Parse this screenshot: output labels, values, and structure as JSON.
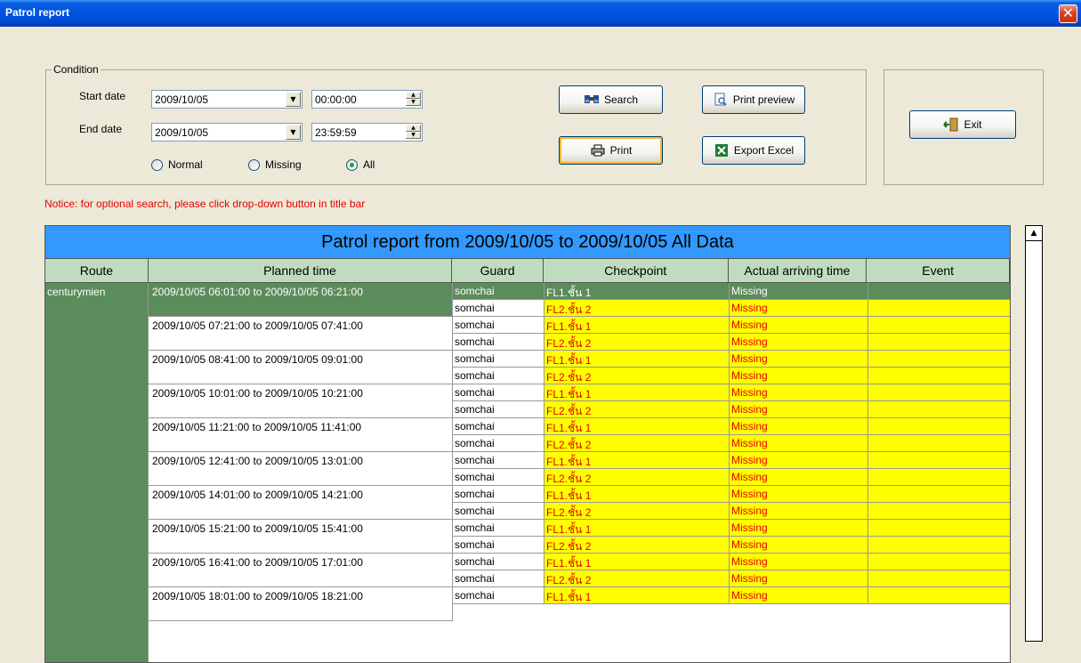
{
  "window": {
    "title": "Patrol report",
    "close_glyph": "✕"
  },
  "condition": {
    "legend": "Condition",
    "start_label": "Start date",
    "end_label": "End date",
    "start_date": "2009/10/05",
    "start_time": "00:00:00",
    "end_date": "2009/10/05",
    "end_time": "23:59:59",
    "radio_normal": "Normal",
    "radio_missing": "Missing",
    "radio_all": "All",
    "selected_radio": "All"
  },
  "buttons": {
    "search": "Search",
    "print_preview": "Print preview",
    "print": "Print",
    "export_excel": "Export Excel",
    "exit": "Exit"
  },
  "notice": "Notice: for optional search, please click drop-down button in title bar",
  "grid": {
    "title": "Patrol report from 2009/10/05 to 2009/10/05  All Data",
    "headers": [
      "Route",
      "Planned time",
      "Guard",
      "Checkpoint",
      "Actual arriving time",
      "Event"
    ],
    "route": "centurymien",
    "planned": [
      "2009/10/05 06:01:00  to  2009/10/05 06:21:00",
      "2009/10/05 07:21:00  to  2009/10/05 07:41:00",
      "2009/10/05 08:41:00  to  2009/10/05 09:01:00",
      "2009/10/05 10:01:00  to  2009/10/05 10:21:00",
      "2009/10/05 11:21:00  to  2009/10/05 11:41:00",
      "2009/10/05 12:41:00  to  2009/10/05 13:01:00",
      "2009/10/05 14:01:00  to  2009/10/05 14:21:00",
      "2009/10/05 15:21:00  to  2009/10/05 15:41:00",
      "2009/10/05 16:41:00  to  2009/10/05 17:01:00",
      "2009/10/05 18:01:00  to  2009/10/05 18:21:00"
    ],
    "rows": [
      {
        "guard": "somchai",
        "checkpoint": "FL1.ชั้น 1",
        "actual": "Missing",
        "event": ""
      },
      {
        "guard": "somchai",
        "checkpoint": "FL2.ชั้น 2",
        "actual": "Missing",
        "event": ""
      },
      {
        "guard": "somchai",
        "checkpoint": "FL1.ชั้น 1",
        "actual": "Missing",
        "event": ""
      },
      {
        "guard": "somchai",
        "checkpoint": "FL2.ชั้น 2",
        "actual": "Missing",
        "event": ""
      },
      {
        "guard": "somchai",
        "checkpoint": "FL1.ชั้น 1",
        "actual": "Missing",
        "event": ""
      },
      {
        "guard": "somchai",
        "checkpoint": "FL2.ชั้น 2",
        "actual": "Missing",
        "event": ""
      },
      {
        "guard": "somchai",
        "checkpoint": "FL1.ชั้น 1",
        "actual": "Missing",
        "event": ""
      },
      {
        "guard": "somchai",
        "checkpoint": "FL2.ชั้น 2",
        "actual": "Missing",
        "event": ""
      },
      {
        "guard": "somchai",
        "checkpoint": "FL1.ชั้น 1",
        "actual": "Missing",
        "event": ""
      },
      {
        "guard": "somchai",
        "checkpoint": "FL2.ชั้น 2",
        "actual": "Missing",
        "event": ""
      },
      {
        "guard": "somchai",
        "checkpoint": "FL1.ชั้น 1",
        "actual": "Missing",
        "event": ""
      },
      {
        "guard": "somchai",
        "checkpoint": "FL2.ชั้น 2",
        "actual": "Missing",
        "event": ""
      },
      {
        "guard": "somchai",
        "checkpoint": "FL1.ชั้น 1",
        "actual": "Missing",
        "event": ""
      },
      {
        "guard": "somchai",
        "checkpoint": "FL2.ชั้น 2",
        "actual": "Missing",
        "event": ""
      },
      {
        "guard": "somchai",
        "checkpoint": "FL1.ชั้น 1",
        "actual": "Missing",
        "event": ""
      },
      {
        "guard": "somchai",
        "checkpoint": "FL2.ชั้น 2",
        "actual": "Missing",
        "event": ""
      },
      {
        "guard": "somchai",
        "checkpoint": "FL1.ชั้น 1",
        "actual": "Missing",
        "event": ""
      },
      {
        "guard": "somchai",
        "checkpoint": "FL2.ชั้น 2",
        "actual": "Missing",
        "event": ""
      },
      {
        "guard": "somchai",
        "checkpoint": "FL1.ชั้น 1",
        "actual": "Missing",
        "event": ""
      }
    ],
    "selected_row": 0
  },
  "colors": {
    "title_bar": "#0054e3",
    "grid_title_bg": "#3399ff",
    "header_bg": "#c0dcc0",
    "selected_bg": "#5b8c5b",
    "missing_bg": "#ffff00",
    "missing_text": "#e60000"
  }
}
